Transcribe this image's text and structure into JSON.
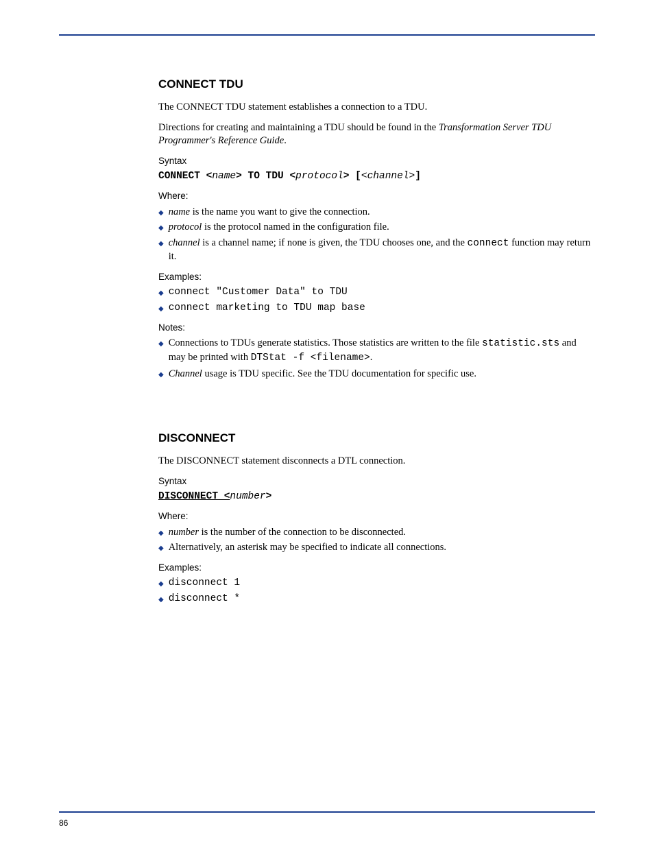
{
  "section1": {
    "title": "CONNECT TDU",
    "intro": "The CONNECT TDU statement establishes a connection to a TDU.",
    "directions_pre": "Directions for creating and maintaining a TDU should be found in the",
    "directions_link": "Transformation Server TDU Programmer's Reference Guide",
    "directions_post": ".",
    "syntax_label": "Syntax",
    "syntax_parts": {
      "p1": "CONNECT <",
      "p2": "name",
      "p3": "> TO TDU <",
      "p4": "protocol",
      "p5": "> [",
      "p6": "<channel>",
      "p7": "]"
    },
    "where_label": "Where:",
    "where_items": [
      {
        "pre": "",
        "ital": "name",
        "post": " is the name you want to give the connection."
      },
      {
        "pre": "",
        "ital": "protocol",
        "post": " is the protocol named in the configuration file."
      },
      {
        "pre": "",
        "ital": "channel",
        "post": " is a channel name; if none is given, the TDU chooses one, and the ",
        "mono": "connect",
        "post2": " function may return it."
      }
    ],
    "examples_label": "Examples:",
    "examples": [
      "connect \"Customer Data\" to TDU",
      "connect marketing to TDU map base"
    ],
    "notes_label": "Notes:",
    "notes": [
      {
        "pre": "Connections to TDUs generate statistics. Those statistics are written to the file ",
        "mono1": "statistic.sts",
        "mid": " and may be printed with ",
        "mono2": "DTStat -f <filename>",
        "post": "."
      },
      {
        "pre": "",
        "ital": "Channel",
        "post": " usage is TDU specific. See the TDU documentation for specific use."
      }
    ]
  },
  "section2": {
    "title": "DISCONNECT",
    "intro": "The DISCONNECT statement disconnects a DTL connection.",
    "syntax_label": "Syntax",
    "syntax_parts": {
      "p1": "DISCONNECT <",
      "p2": "number",
      "p3": ">"
    },
    "where_label": "Where:",
    "where_items": [
      {
        "pre": "",
        "ital": "number",
        "post": " is the number of the connection to be disconnected."
      },
      {
        "pre": "Alternatively, an asterisk may be specified to indicate all connections.",
        "ital": "",
        "post": ""
      }
    ],
    "examples_label": "Examples:",
    "examples": [
      "disconnect 1",
      "disconnect *"
    ]
  },
  "page_number": "86"
}
